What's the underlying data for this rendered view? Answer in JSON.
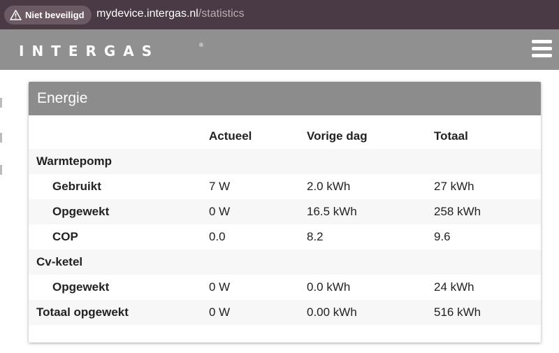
{
  "browser": {
    "security_label": "Niet beveiligd",
    "url_host": "mydevice.intergas.nl",
    "url_path": "/statistics"
  },
  "header": {
    "brand": "INTERGAS",
    "brand_mark": "®",
    "menu_icon": "hamburger-menu-icon"
  },
  "card": {
    "title": "Energie",
    "columns": [
      "",
      "Actueel",
      "Vorige dag",
      "Totaal"
    ],
    "rows": [
      {
        "label": "Warmtepomp",
        "actueel": "",
        "vorige_dag": "",
        "totaal": ""
      },
      {
        "label": "Gebruikt",
        "actueel": "7 W",
        "vorige_dag": "2.0 kWh",
        "totaal": "27 kWh"
      },
      {
        "label": "Opgewekt",
        "actueel": "0 W",
        "vorige_dag": "16.5 kWh",
        "totaal": "258 kWh"
      },
      {
        "label": "COP",
        "actueel": "0.0",
        "vorige_dag": "8.2",
        "totaal": "9.6"
      },
      {
        "label": "Cv-ketel",
        "actueel": "",
        "vorige_dag": "",
        "totaal": ""
      },
      {
        "label": "Opgewekt",
        "actueel": "0 W",
        "vorige_dag": "0.0 kWh",
        "totaal": "24 kWh"
      },
      {
        "label": "Totaal opgewekt",
        "actueel": "0 W",
        "vorige_dag": "0.00 kWh",
        "totaal": "516 kWh"
      }
    ]
  }
}
